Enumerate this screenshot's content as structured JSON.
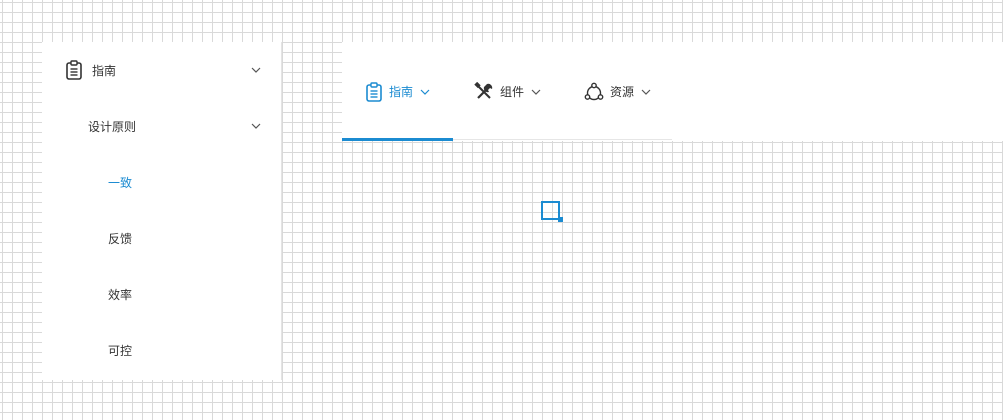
{
  "vertical_menu": {
    "guide_label": "指南",
    "group_label": "设计原则",
    "items": [
      {
        "label": "一致"
      },
      {
        "label": "反馈"
      },
      {
        "label": "效率"
      },
      {
        "label": "可控"
      }
    ],
    "active_item": "一致"
  },
  "horizontal_menu": {
    "items": [
      {
        "label": "指南",
        "icon": "clipboard-icon"
      },
      {
        "label": "组件",
        "icon": "tools-icon"
      },
      {
        "label": "资源",
        "icon": "network-icon"
      }
    ],
    "active_item": "指南"
  },
  "colors": {
    "accent": "#1b8bd1",
    "text": "#333333",
    "grid": "#d9d9d9"
  }
}
